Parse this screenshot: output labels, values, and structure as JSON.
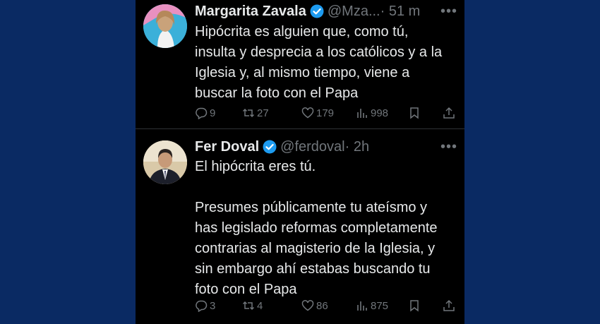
{
  "tweets": [
    {
      "name": "Margarita Zavala",
      "handle": "@Mza...",
      "time": "· 51 m",
      "text": "Hipócrita es alguien que, como tú,\ninsulta y desprecia a los católicos y a la\nIglesia y, al mismo tiempo, viene a\nbuscar la foto con el Papa",
      "replies": "9",
      "retweets": "27",
      "likes": "179",
      "views": "998"
    },
    {
      "name": "Fer Doval",
      "handle": "@ferdoval",
      "time": "· 2h",
      "text": "El hipócrita eres tú.\n\nPresumes públicamente tu ateísmo y\nhas legislado reformas completamente\ncontrarias al magisterio de la Iglesia, y\nsin embargo ahí estabas buscando tu\nfoto con el Papa",
      "replies": "3",
      "retweets": "4",
      "likes": "86",
      "views": "875"
    }
  ],
  "icons": {
    "more": "more-icon",
    "verified": "verified-badge-icon",
    "reply": "reply-icon",
    "retweet": "retweet-icon",
    "like": "heart-icon",
    "views": "views-icon",
    "bookmark": "bookmark-icon",
    "share": "share-icon"
  },
  "colors": {
    "background": "#0a2a63",
    "card": "#000000",
    "text": "#e7e9ea",
    "secondary": "#71767b",
    "verified": "#1d9bf0"
  }
}
